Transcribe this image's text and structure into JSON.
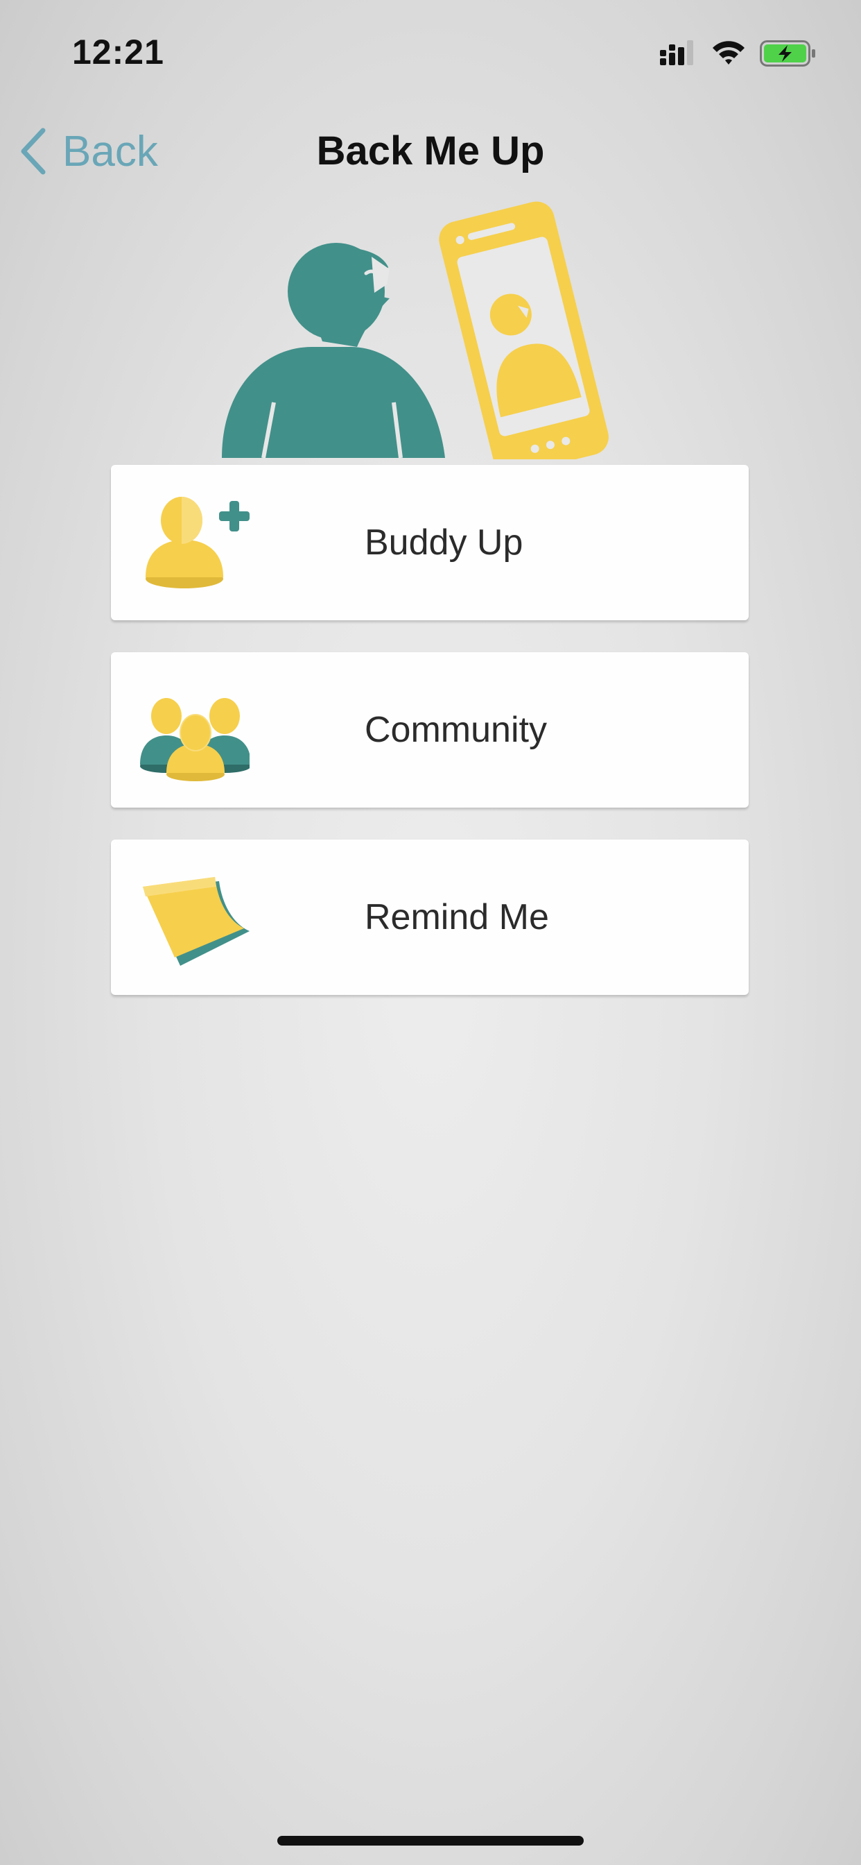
{
  "status_bar": {
    "time": "12:21",
    "icons": [
      "cellular-signal-icon",
      "wifi-icon",
      "battery-charging-icon"
    ]
  },
  "nav": {
    "back_label": "Back",
    "title": "Back Me Up"
  },
  "menu": {
    "items": [
      {
        "label": "Buddy Up",
        "icon": "add-buddy-icon"
      },
      {
        "label": "Community",
        "icon": "community-icon"
      },
      {
        "label": "Remind Me",
        "icon": "sticky-note-icon"
      }
    ]
  },
  "colors": {
    "accent_teal": "#42908a",
    "accent_yellow": "#f6cf4c",
    "back_link": "#69a6b7",
    "battery_green": "#4fd14a"
  }
}
